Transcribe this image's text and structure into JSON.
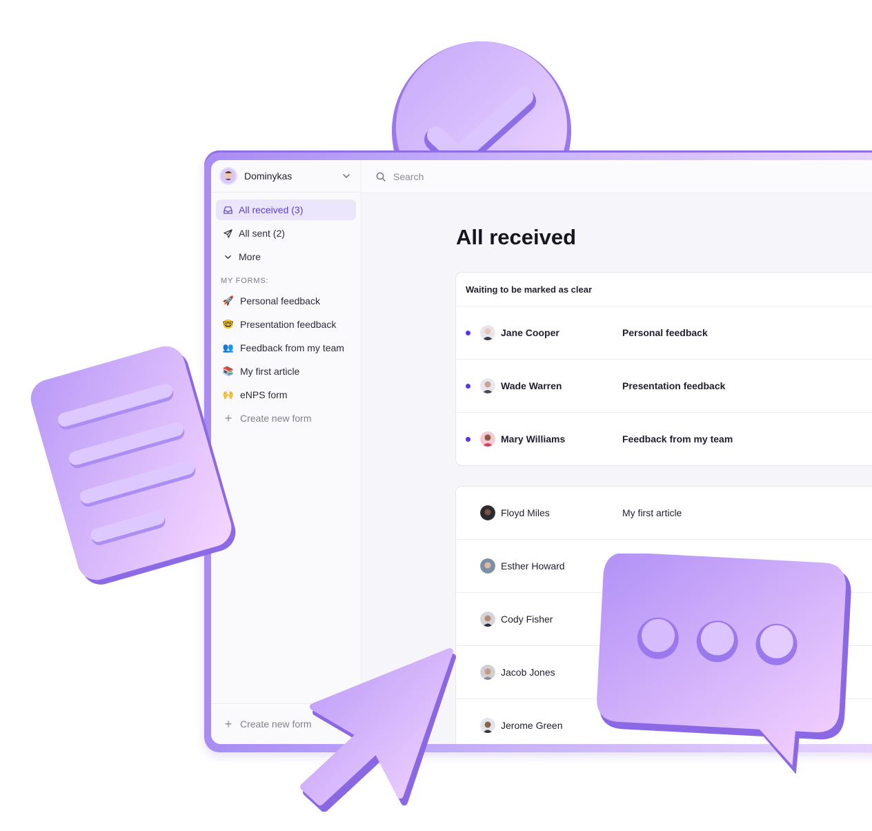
{
  "account": {
    "name": "Dominykas"
  },
  "nav": [
    {
      "label": "All received (3)",
      "icon": "inbox-icon",
      "active": true
    },
    {
      "label": "All sent (2)",
      "icon": "send-icon",
      "active": false
    },
    {
      "label": "More",
      "icon": "chevron-down-icon",
      "active": false
    }
  ],
  "forms_section": {
    "title": "MY FORMS:",
    "items": [
      {
        "emoji": "🚀",
        "icon": "rocket-icon",
        "label": "Personal feedback"
      },
      {
        "emoji": "🤓",
        "icon": "nerd-face-icon",
        "label": "Presentation feedback"
      },
      {
        "emoji": "👥",
        "icon": "people-icon",
        "label": "Feedback from my team"
      },
      {
        "emoji": "📚",
        "icon": "books-icon",
        "label": "My first article"
      },
      {
        "emoji": "🙌",
        "icon": "raised-hands-icon",
        "label": "eNPS form"
      }
    ],
    "create_label": "Create new form"
  },
  "footer": {
    "create_label": "Create new form"
  },
  "search": {
    "placeholder": "Search"
  },
  "page": {
    "title": "All received"
  },
  "waiting": {
    "header": "Waiting to be marked as clear",
    "rows": [
      {
        "name": "Jane Cooper",
        "form": "Personal feedback",
        "avatar_color": "#e9c6b8"
      },
      {
        "name": "Wade Warren",
        "form": "Presentation feedback",
        "avatar_color": "#4a4a55"
      },
      {
        "name": "Mary Williams",
        "form": "Feedback from my team",
        "avatar_color": "#d2435c"
      }
    ]
  },
  "cleared": {
    "rows": [
      {
        "name": "Floyd Miles",
        "form": "My first article",
        "avatar_color": "#2a2a30"
      },
      {
        "name": "Esther Howard",
        "form": "",
        "avatar_color": "#7a8fa8"
      },
      {
        "name": "Cody Fisher",
        "form": "",
        "avatar_color": "#b9b9bf"
      },
      {
        "name": "Jacob Jones",
        "form": "",
        "avatar_color": "#8c8c94"
      },
      {
        "name": "Jerome Green",
        "form": "",
        "avatar_color": "#35353c"
      }
    ]
  },
  "colors": {
    "accent": "#5c34e6",
    "active_bg": "#ece6fd",
    "decoration": "#b99cf6"
  }
}
